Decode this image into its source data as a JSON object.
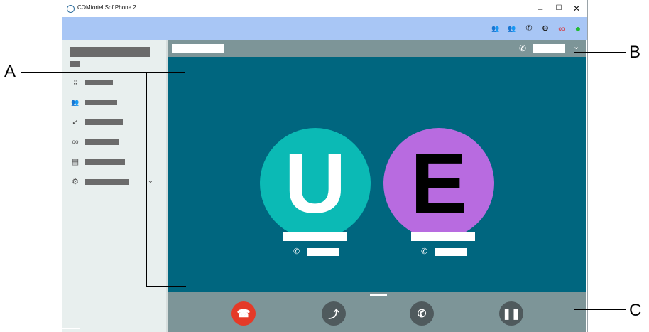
{
  "window": {
    "title": "COMfortel SoftPhone 2",
    "controls": {
      "minimize": "–",
      "maximize": "☐",
      "close": "✕"
    }
  },
  "toolbar": {
    "icons": [
      {
        "name": "contacts-icon",
        "glyph": "👥",
        "color": "#3a3a3a"
      },
      {
        "name": "group-icon",
        "glyph": "👥",
        "color": "#2e9b4a"
      },
      {
        "name": "call-forward-icon",
        "glyph": "✆",
        "color": "#2a2a2a"
      },
      {
        "name": "do-not-disturb-icon",
        "glyph": "⊖",
        "color": "#2a2a2a"
      },
      {
        "name": "voicemail-icon",
        "glyph": "ᴏᴏ",
        "color": "#d22"
      },
      {
        "name": "status-online-icon",
        "glyph": "●",
        "color": "#22bb33"
      }
    ]
  },
  "annotations": {
    "a": "A",
    "b": "B",
    "c": "C"
  },
  "participants": [
    {
      "initial": "U",
      "color": "#0bbab5",
      "text_color": "#ffffff"
    },
    {
      "initial": "E",
      "color": "#b86be0",
      "text_color": "#000000"
    }
  ],
  "controls": {
    "hangup_color": "#e53a28",
    "button_color": "#4f5a5d"
  }
}
